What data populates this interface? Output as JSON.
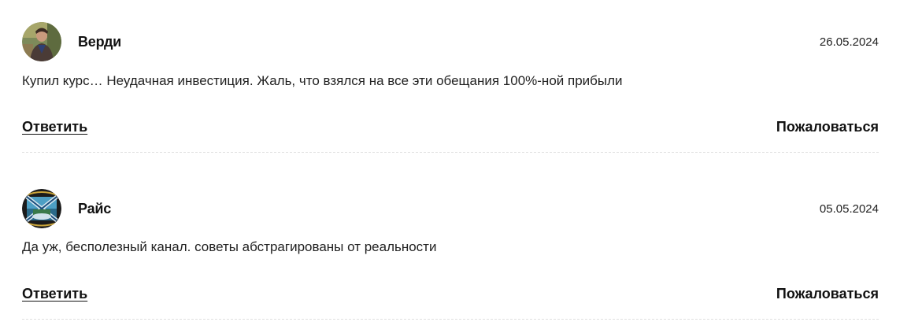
{
  "comments": [
    {
      "author": "Верди",
      "date": "26.05.2024",
      "text": "Купил курс… Неудачная инвестиция. Жаль, что взялся на все эти обещания 100%-ной прибыли",
      "reply_label": "Ответить",
      "report_label": "Пожаловаться"
    },
    {
      "author": "Райс",
      "date": "05.05.2024",
      "text": "Да уж, бесполезный канал. советы абстрагированы от реальности",
      "reply_label": "Ответить",
      "report_label": "Пожаловаться"
    }
  ]
}
